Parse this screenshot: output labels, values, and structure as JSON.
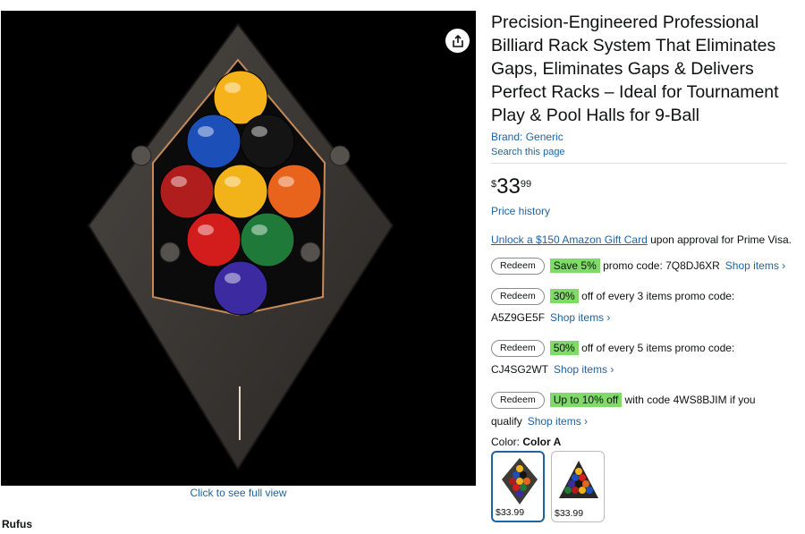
{
  "product": {
    "title": "Precision-Engineered Professional Billiard Rack System That Eliminates Gaps, Eliminates Gaps & Delivers Perfect Racks – Ideal for Tournament Play & Pool Halls for 9-Ball",
    "brand": "Brand: Generic",
    "search_page": "Search this page",
    "price": {
      "symbol": "$",
      "whole": "33",
      "fraction": "99"
    },
    "price_history": "Price history"
  },
  "gift": {
    "link": "Unlock a $150 Amazon Gift Card",
    "text": " upon approval for Prime Visa."
  },
  "promos": [
    {
      "button": "Redeem",
      "highlight": "Save 5%",
      "text": " promo code: 7Q8DJ6XR",
      "shop": "Shop items ›"
    },
    {
      "button": "Redeem",
      "highlight": "30%",
      "text": " off of every 3 items promo code: A5Z9GE5F",
      "shop": "Shop items ›"
    },
    {
      "button": "Redeem",
      "highlight": "50%",
      "text": " off of every 5 items promo code: CJ4SG2WT",
      "shop": "Shop items ›"
    },
    {
      "button": "Redeem",
      "highlight": "Up to 10% off",
      "text": " with code 4WS8BJIM if you qualify",
      "shop": "Shop items ›"
    }
  ],
  "color": {
    "label": "Color: ",
    "selected": "Color A",
    "options": [
      {
        "price": "$33.99",
        "selected": true
      },
      {
        "price": "$33.99",
        "selected": false
      }
    ]
  },
  "gallery": {
    "full_view": "Click to see full view",
    "share_icon": "share-icon"
  },
  "rufus": "Rufus",
  "image": {
    "ball_colors": [
      "#f6b21a",
      "#1c4fb8",
      "#141414",
      "#b01d1d",
      "#f2b21a",
      "#e8641c",
      "#d31c1c",
      "#1f7a3a",
      "#3b2aa0"
    ],
    "rack_color": "#3e3a36",
    "accent_color": "#c48a5a"
  }
}
